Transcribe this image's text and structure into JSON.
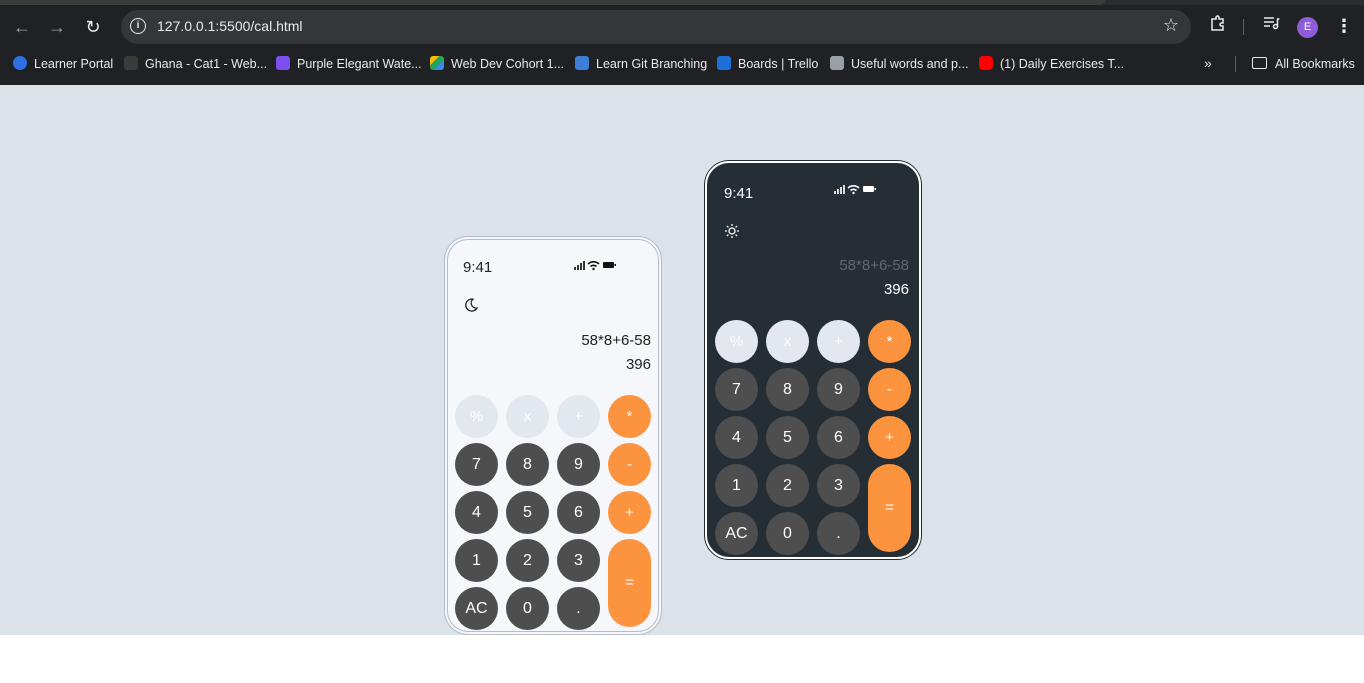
{
  "browser": {
    "url": "127.0.0.1:5500/cal.html",
    "avatar_letter": "E",
    "bookmarks": [
      {
        "label": "Learner Portal",
        "color": "#2f6fe4"
      },
      {
        "label": "Ghana - Cat1 - Web...",
        "color": "#3a3a3a"
      },
      {
        "label": "Purple Elegant Wate...",
        "color": "#7b4ff0"
      },
      {
        "label": "Web Dev Cohort 1...",
        "color": "#1fa463"
      },
      {
        "label": "Learn Git Branching",
        "color": "#3d7fd6"
      },
      {
        "label": "Boards | Trello",
        "color": "#1d6fd9"
      },
      {
        "label": "Useful words and p...",
        "color": "#9aa0a6"
      },
      {
        "label": "(1) Daily Exercises T...",
        "color": "#ff0000"
      }
    ],
    "all_bookmarks": "All Bookmarks"
  },
  "light_calc": {
    "time": "9:41",
    "mode_icon": "moon-icon",
    "expression": "58*8+6-58",
    "result": "396"
  },
  "dark_calc": {
    "time": "9:41",
    "mode_icon": "sun-icon",
    "expression": "58*8+6-58",
    "result": "396"
  },
  "keys": {
    "percent": "%",
    "x": "x",
    "plus_util": "+",
    "multiply": "*",
    "seven": "7",
    "eight": "8",
    "nine": "9",
    "minus": "-",
    "four": "4",
    "five": "5",
    "six": "6",
    "plus": "+",
    "one": "1",
    "two": "2",
    "three": "3",
    "equals": "=",
    "ac": "AC",
    "zero": "0",
    "dot": "."
  },
  "colors": {
    "page_bg": "#dce2ea",
    "operator": "#fc933e",
    "number_key": "#4e4e4e",
    "util_key": "#e3e7ee",
    "dark_phone": "#252d35",
    "light_phone": "#f5f7fb"
  }
}
